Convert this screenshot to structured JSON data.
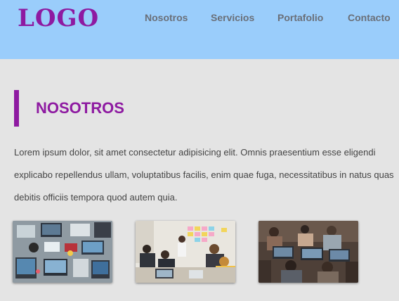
{
  "header": {
    "logo": "LOGO",
    "nav": [
      "Nosotros",
      "Servicios",
      "Portafolio",
      "Contacto"
    ]
  },
  "section": {
    "title": "NOSOTROS",
    "body": "Lorem ipsum dolor, sit amet consectetur adipisicing elit. Omnis praesentium esse eligendi explicabo repellendus ullam, voluptatibus facilis, enim quae fuga, necessitatibus in natus quas debitis officiis tempora quod autem quia."
  },
  "colors": {
    "header_bg": "#9acdfb",
    "accent": "#8e1aa1",
    "page_bg": "#e4e4e4"
  },
  "gallery": {
    "images": [
      "team-desk-photo",
      "office-meeting-photo",
      "coworking-photo"
    ]
  }
}
